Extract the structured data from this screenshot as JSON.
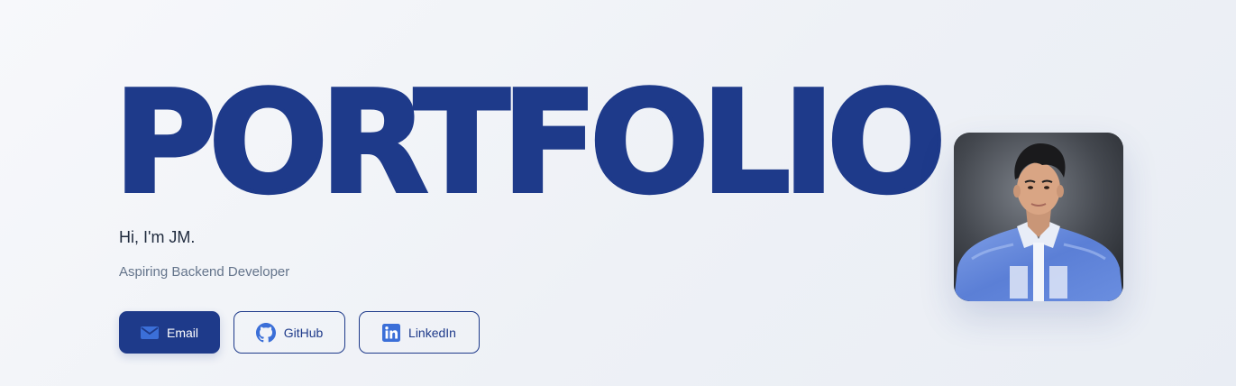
{
  "hero": {
    "title": "PORTFOLIO",
    "greeting": "Hi, I'm JM.",
    "role": "Aspiring Backend Developer"
  },
  "buttons": {
    "email": {
      "label": "Email",
      "icon": "mail-icon"
    },
    "github": {
      "label": "GitHub",
      "icon": "github-icon"
    },
    "linkedin": {
      "label": "LinkedIn",
      "icon": "linkedin-icon"
    }
  },
  "profile_photo": {
    "description": "profile-photo",
    "shirt_color": "#5b7fd6"
  },
  "colors": {
    "accent": "#1e3a8a",
    "text": "#1f2a3d",
    "muted": "#64748b",
    "icon_blue": "#3b6fd8"
  }
}
